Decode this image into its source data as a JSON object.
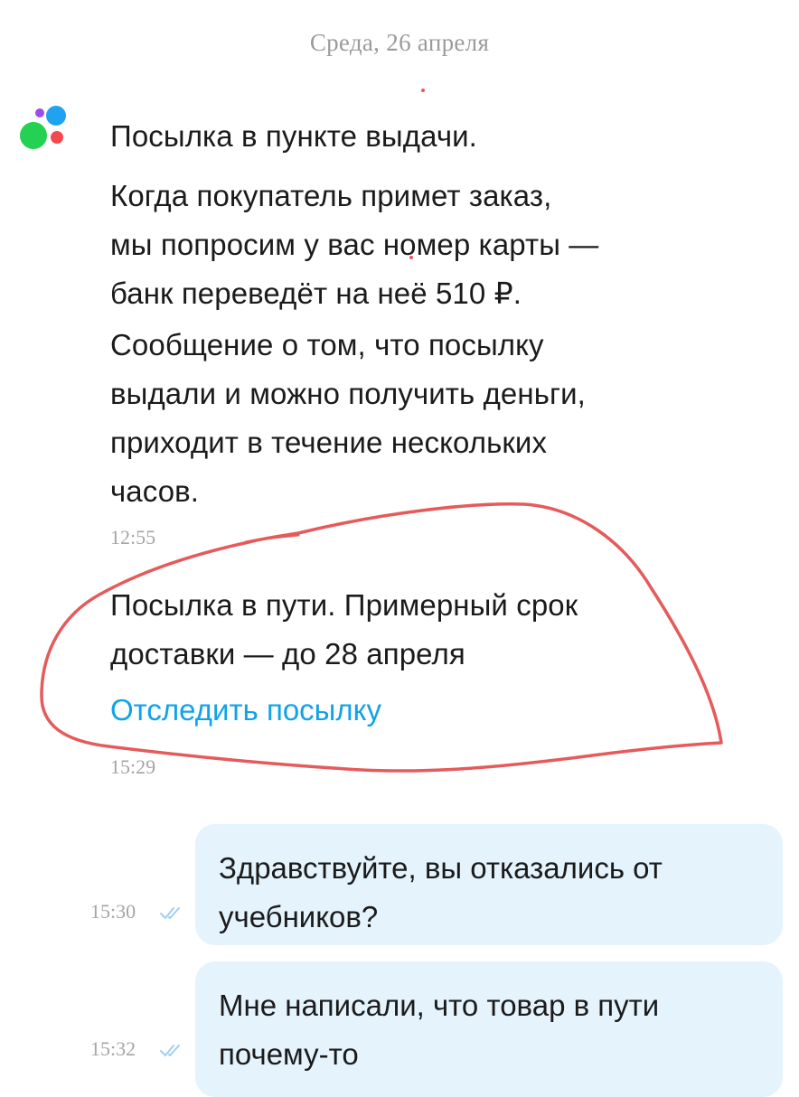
{
  "chat": {
    "date_divider": "Среда, 26 апреля",
    "incoming": [
      {
        "paragraphs": [
          "Посылка в пункте выдачи.",
          "Когда покупатель примет заказ,\nмы попросим у вас номер карты —\nбанк переведёт на неё 510 ₽.",
          "Сообщение о том, что посылку\nвыдали и можно получить деньги,\nприходит в течение нескольких\nчасов."
        ],
        "time": "12:55"
      },
      {
        "text": "Посылка в пути. Примерный срок\nдоставки — до 28 апреля",
        "link": "Отследить посылку",
        "time": "15:29"
      }
    ],
    "outgoing": [
      {
        "text": "Здравствуйте,  вы отказались от\nучебников?",
        "time": "15:30",
        "status_icon": "double-check-icon"
      },
      {
        "text": "Мне написали,  что товар в пути\nпочему-то",
        "time": "15:32",
        "status_icon": "double-check-icon"
      }
    ]
  },
  "colors": {
    "link": "#11a3e6",
    "outgoing_bubble": "#e4f3fc",
    "annotation_circle": "#e55a5a",
    "logo_green": "#25d152",
    "logo_blue": "#1fa3f0",
    "logo_red": "#f4484e",
    "logo_purple": "#9b4dea"
  }
}
